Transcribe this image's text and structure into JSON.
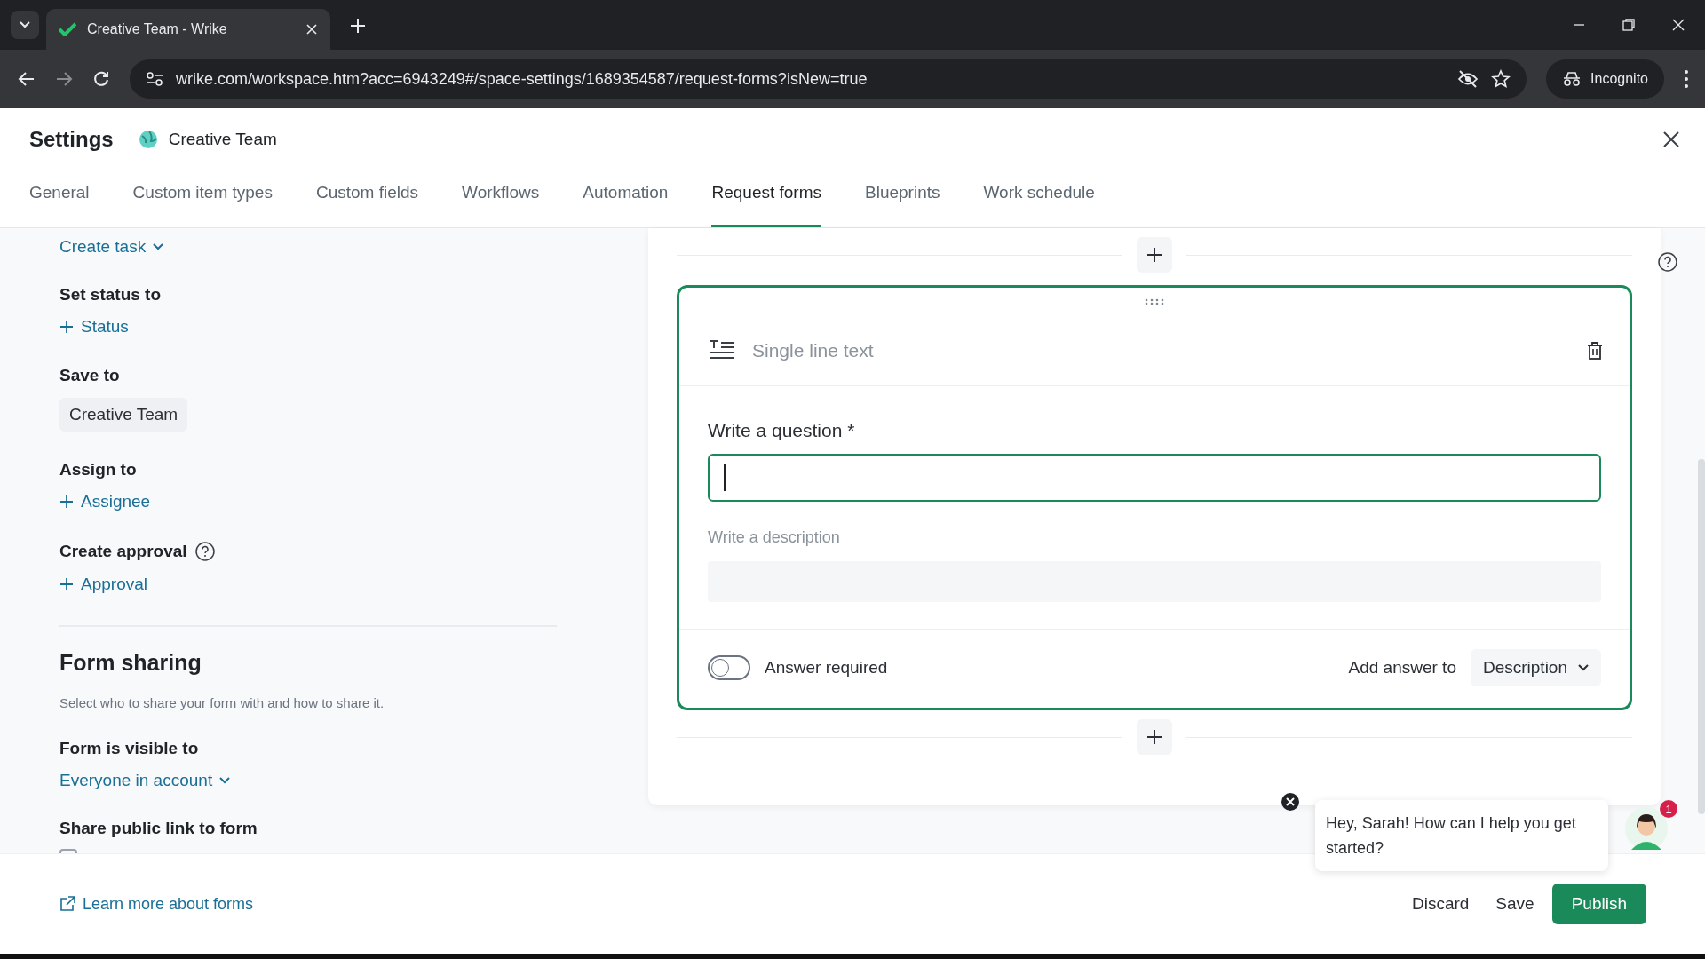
{
  "browser": {
    "tab_title": "Creative Team - Wrike",
    "url": "wrike.com/workspace.htm?acc=6943249#/space-settings/1689354587/request-forms?isNew=true",
    "profile": "Incognito"
  },
  "header": {
    "title": "Settings",
    "space": "Creative Team"
  },
  "tabs": [
    {
      "label": "General",
      "selected": false
    },
    {
      "label": "Custom item types",
      "selected": false
    },
    {
      "label": "Custom fields",
      "selected": false
    },
    {
      "label": "Workflows",
      "selected": false
    },
    {
      "label": "Automation",
      "selected": false
    },
    {
      "label": "Request forms",
      "selected": true
    },
    {
      "label": "Blueprints",
      "selected": false
    },
    {
      "label": "Work schedule",
      "selected": false
    }
  ],
  "sidebar": {
    "action_link": "Create task",
    "sections": [
      {
        "label": "Set status to",
        "kind": "add",
        "value": "Status",
        "help": false
      },
      {
        "label": "Save to",
        "kind": "chip",
        "value": "Creative Team",
        "help": false
      },
      {
        "label": "Assign to",
        "kind": "add",
        "value": "Assignee",
        "help": false
      },
      {
        "label": "Create approval",
        "kind": "add",
        "value": "Approval",
        "help": true
      }
    ],
    "sharing": {
      "title": "Form sharing",
      "description": "Select who to share your form with and how to share it.",
      "visibility_label": "Form is visible to",
      "visibility": "Everyone in account",
      "public_link_label": "Share public link to form",
      "public_link_enabled": false
    }
  },
  "question_card": {
    "type_label": "Single line text",
    "question_label": "Write a question *",
    "description_placeholder": "Write a description",
    "answer_required": false,
    "required_label": "Answer required",
    "add_answer_label": "Add answer to",
    "add_answer_value": "Description"
  },
  "footer": {
    "link": "Learn more about forms",
    "buttons": [
      {
        "label": "Discard",
        "kind": "text"
      },
      {
        "label": "Save",
        "kind": "text"
      },
      {
        "label": "Publish",
        "kind": "primary"
      }
    ]
  },
  "chat": {
    "message": "Hey, Sarah! How can I help you get started?",
    "badge": "1"
  }
}
